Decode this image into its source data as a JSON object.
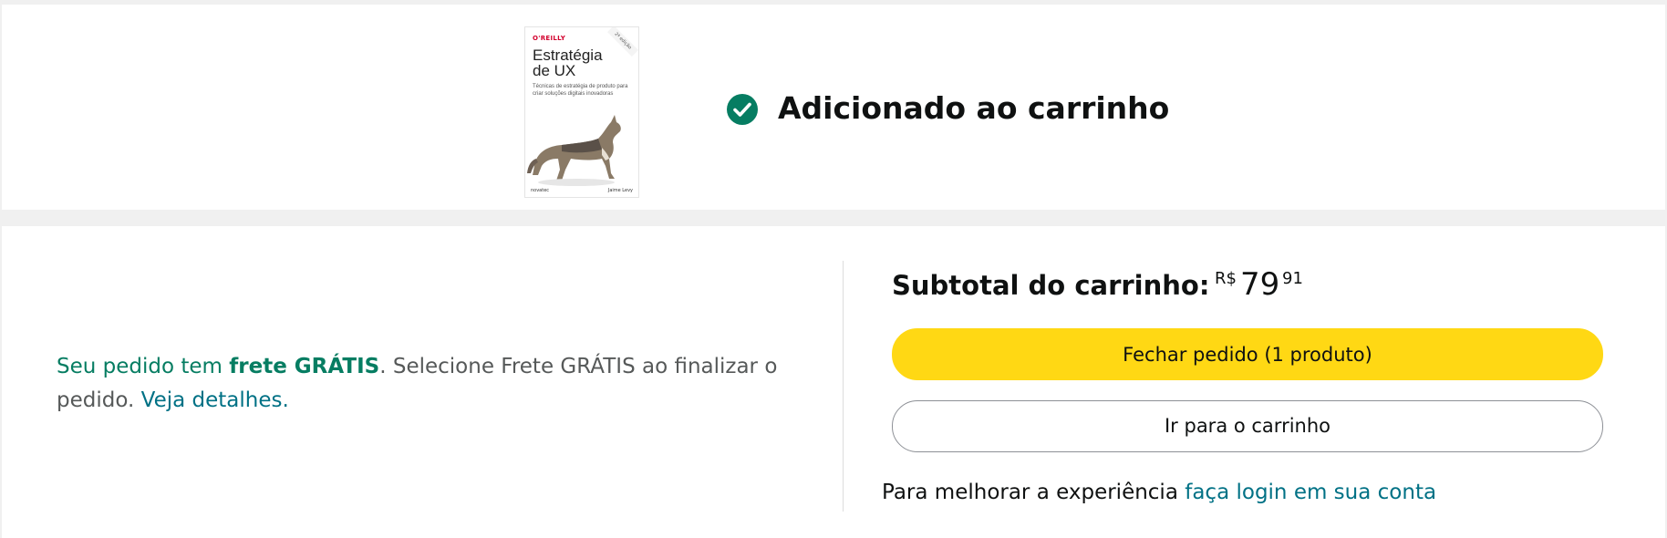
{
  "confirmation": {
    "title": "Adicionado ao carrinho",
    "product_cover": {
      "publisher": "O'REILLY",
      "edition_badge": "2ª edição",
      "title_line1": "Estratégia",
      "title_line2": "de UX",
      "subtitle": "Técnicas de estratégia de produto para criar soluções digitais inovadoras",
      "imprint": "novatec",
      "author": "Jaime Levy"
    }
  },
  "shipping_notice": {
    "prefix": "Seu pedido tem ",
    "highlight": "frete GRÁTIS",
    "middle": ". Selecione Frete GRÁTIS ao finalizar o pedido. ",
    "details_link": "Veja detalhes."
  },
  "subtotal": {
    "label": "Subtotal do carrinho:",
    "currency": "R$",
    "whole": "79",
    "fraction": "91"
  },
  "buttons": {
    "checkout": "Fechar pedido (1 produto)",
    "go_to_cart": "Ir para o carrinho"
  },
  "login_prompt": {
    "text": "Para melhorar a experiência ",
    "link": "faça login em sua conta"
  },
  "colors": {
    "accent_green": "#067d62",
    "link": "#007185",
    "checkout_button": "#ffd814"
  }
}
